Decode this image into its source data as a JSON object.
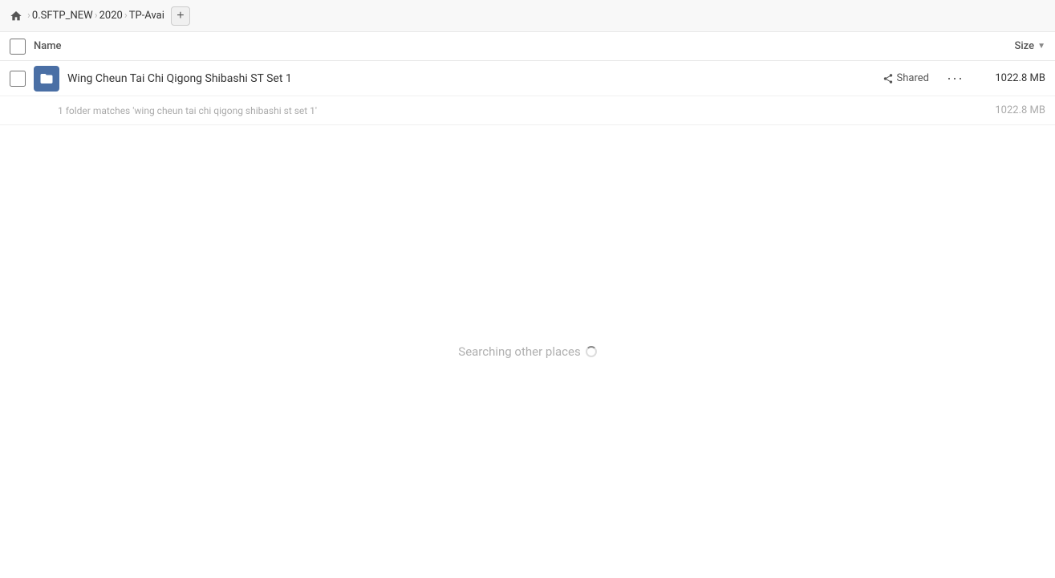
{
  "breadcrumb": {
    "home_label": "Home",
    "items": [
      {
        "label": "0.SFTP_NEW"
      },
      {
        "label": "2020"
      },
      {
        "label": "TP-Avai"
      }
    ],
    "add_tab_label": "+"
  },
  "table": {
    "header": {
      "name_label": "Name",
      "size_label": "Size"
    },
    "rows": [
      {
        "name": "Wing Cheun Tai Chi Qigong Shibashi ST Set 1",
        "shared_label": "Shared",
        "size": "1022.8 MB"
      }
    ],
    "match_info": "1 folder matches 'wing cheun tai chi qigong shibashi st set 1'",
    "match_size": "1022.8 MB"
  },
  "status": {
    "searching_text": "Searching other places"
  }
}
